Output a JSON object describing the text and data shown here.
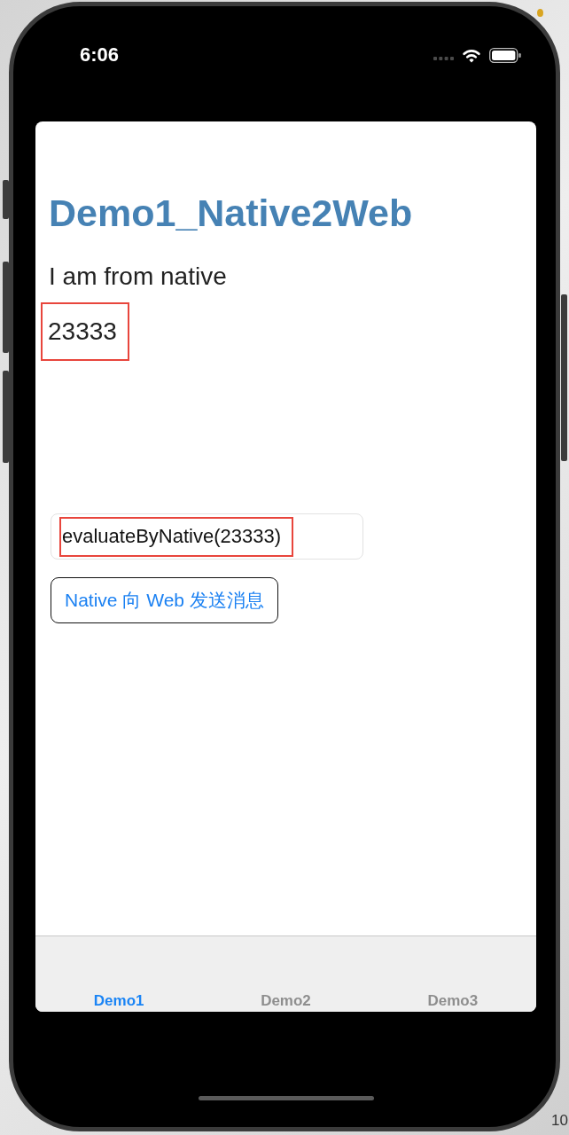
{
  "status_bar": {
    "time": "6:06"
  },
  "page": {
    "title": "Demo1_Native2Web",
    "message": "I am from native",
    "received_value": {
      "text": "23333",
      "highlighted": true
    }
  },
  "input": {
    "value": "evaluateByNative(23333)",
    "highlighted": true
  },
  "send_button": {
    "label": "Native 向 Web 发送消息"
  },
  "tabs": [
    {
      "label": "Demo1",
      "selected": true
    },
    {
      "label": "Demo2",
      "selected": false
    },
    {
      "label": "Demo3",
      "selected": false
    }
  ],
  "background_text": "10"
}
